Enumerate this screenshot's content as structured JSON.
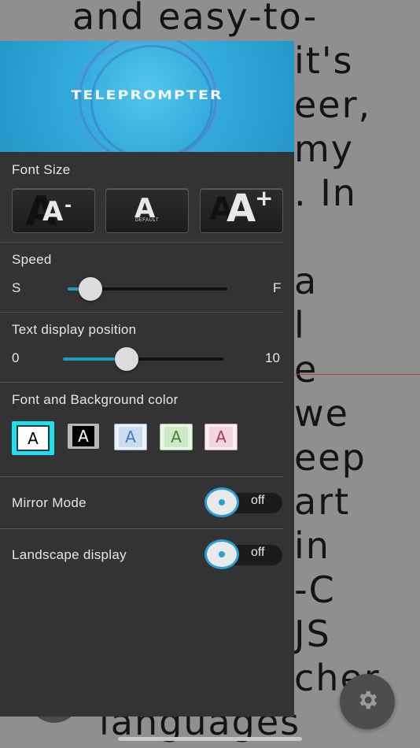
{
  "background_script": {
    "lines": [
      "and easy-to-",
      "it's",
      "eer,",
      "my",
      ".  In",
      "a",
      "l",
      "e",
      "we",
      "eep",
      "art",
      "in",
      "-C",
      "JS",
      "cher",
      "languages"
    ]
  },
  "panel": {
    "banner_title": "TELEPROMPTER",
    "font_size": {
      "label": "Font Size",
      "buttons": [
        {
          "glyph": "A",
          "modifier": "-",
          "name": "decrease"
        },
        {
          "glyph": "A",
          "caption": "DEFAULT",
          "name": "default"
        },
        {
          "glyph": "A",
          "modifier": "+",
          "name": "increase"
        }
      ]
    },
    "speed": {
      "label": "Speed",
      "min_label": "S",
      "max_label": "F",
      "value_fraction": 0.15
    },
    "text_position": {
      "label": "Text display position",
      "min_label": "0",
      "max_label": "10",
      "value": 4
    },
    "color_scheme": {
      "label": "Font and Background color",
      "selected_index": 0,
      "selected_outline": "#1ee0f0",
      "options": [
        {
          "glyph": "A",
          "text_color": "#000000",
          "bg_color": "#ffffff"
        },
        {
          "glyph": "A",
          "text_color": "#ffffff",
          "bg_color": "#000000"
        },
        {
          "glyph": "A",
          "text_color": "#3f7fc4",
          "bg_color": "#d3e2f0"
        },
        {
          "glyph": "A",
          "text_color": "#3a8a2e",
          "bg_color": "#d6ecd0"
        },
        {
          "glyph": "A",
          "text_color": "#b03a60",
          "bg_color": "#f4dde4"
        }
      ]
    },
    "mirror_mode": {
      "label": "Mirror Mode",
      "state": "off"
    },
    "landscape": {
      "label": "Landscape display",
      "state": "off"
    }
  },
  "colors": {
    "accent": "#1f9cc6",
    "panel_bg": "#333333",
    "overlay": "#8f8f8f"
  },
  "icons": {
    "settings": "gear-icon"
  }
}
